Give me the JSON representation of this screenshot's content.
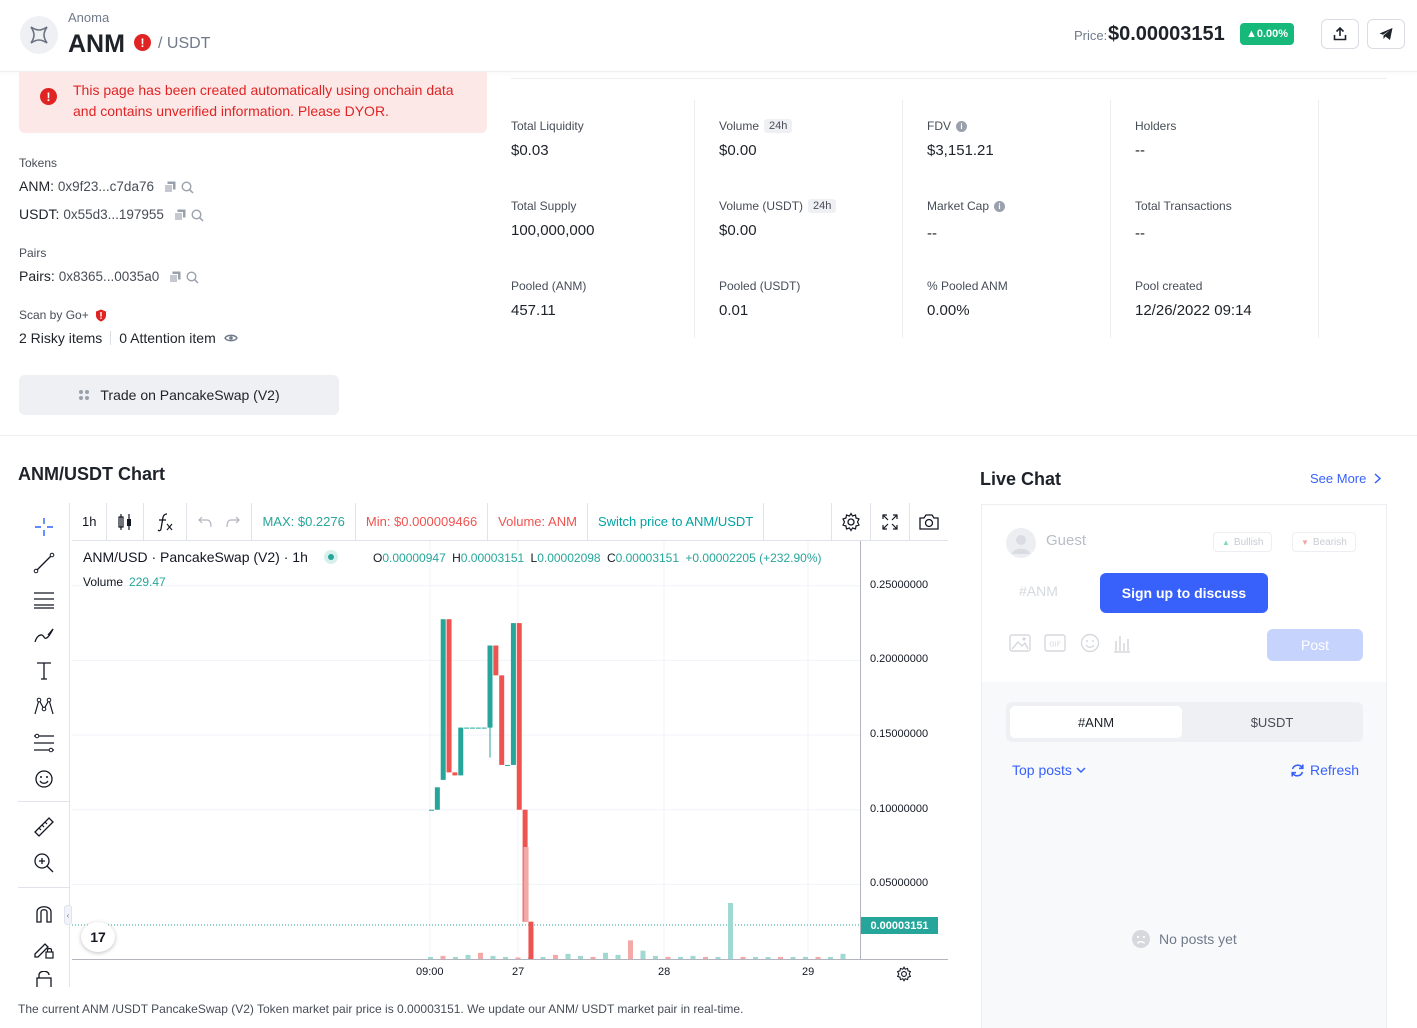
{
  "header": {
    "project_name": "Anoma",
    "symbol": "ANM",
    "quote": "/ USDT",
    "price_label": "Price:",
    "price": "$0.00003151",
    "price_change": "▲0.00%"
  },
  "warning": {
    "text": "This page has been created automatically using onchain data and contains unverified information. Please DYOR."
  },
  "tokens": {
    "label": "Tokens",
    "items": [
      {
        "name": "ANM:",
        "address": "0x9f23...c7da76"
      },
      {
        "name": "USDT:",
        "address": "0x55d3...197955"
      }
    ]
  },
  "pairs": {
    "label": "Pairs",
    "name": "Pairs:",
    "address": "0x8365...0035a0"
  },
  "scan": {
    "label": "Scan by Go+",
    "risky": "2 Risky items",
    "attention": "0 Attention item"
  },
  "trade_button": "Trade on PancakeSwap (V2)",
  "stats": [
    {
      "label": "Total Liquidity",
      "value": "$0.03"
    },
    {
      "label": "Volume",
      "tag": "24h",
      "value": "$0.00"
    },
    {
      "label": "FDV",
      "value": "$3,151.21"
    },
    {
      "label": "Holders",
      "value": "--"
    },
    {
      "label": "Total Supply",
      "value": "100,000,000"
    },
    {
      "label": "Volume (USDT)",
      "tag": "24h",
      "value": "$0.00"
    },
    {
      "label": "Market Cap",
      "value": "--"
    },
    {
      "label": "Total Transactions",
      "value": "--"
    },
    {
      "label": "Pooled (ANM)",
      "value": "457.11"
    },
    {
      "label": "Pooled (USDT)",
      "value": "0.01"
    },
    {
      "label": "% Pooled ANM",
      "value": "0.00%"
    },
    {
      "label": "Pool created",
      "value": "12/26/2022 09:14"
    }
  ],
  "chart": {
    "title": "ANM/USDT Chart",
    "toolbar": {
      "interval": "1h",
      "max": "MAX: $0.2276",
      "min": "Min: $0.000009466",
      "volume": "Volume: ANM",
      "switch": "Switch price to ANM/USDT"
    },
    "legend": "ANM/USD · PancakeSwap (V2) · 1h",
    "ohlc": {
      "o_label": "O",
      "o": "0.00000947",
      "h_label": "H",
      "h": "0.00003151",
      "l_label": "L",
      "l": "0.00002098",
      "c_label": "C",
      "c": "0.00003151",
      "change": "+0.00002205 (+232.90%)"
    },
    "volume_label": "Volume",
    "volume_value": "229.47",
    "last_price_tag": "0.00003151",
    "tv_logo": "17",
    "footnote": "The current ANM /USDT PancakeSwap (V2) Token market pair price is 0.00003151. We update our ANM/ USDT market pair in real-time."
  },
  "chart_data": {
    "type": "candlestick",
    "title": "ANM/USD · PancakeSwap (V2) · 1h",
    "yticks": [
      "0.25000000",
      "0.20000000",
      "0.15000000",
      "0.10000000",
      "0.05000000"
    ],
    "ylim": [
      0,
      0.28
    ],
    "xticks": [
      "09:00",
      "27",
      "28",
      "29"
    ],
    "candles": [
      {
        "o": 0.1,
        "h": 0.1,
        "l": 0.1,
        "c": 0.1
      },
      {
        "o": 0.1,
        "h": 0.115,
        "l": 0.1,
        "c": 0.115
      },
      {
        "o": 0.12,
        "h": 0.2276,
        "l": 0.12,
        "c": 0.2276
      },
      {
        "o": 0.2276,
        "h": 0.2276,
        "l": 0.125,
        "c": 0.125
      },
      {
        "o": 0.125,
        "h": 0.125,
        "l": 0.123,
        "c": 0.123
      },
      {
        "o": 0.123,
        "h": 0.155,
        "l": 0.123,
        "c": 0.155
      },
      {
        "o": 0.155,
        "h": 0.155,
        "l": 0.155,
        "c": 0.155
      },
      {
        "o": 0.155,
        "h": 0.155,
        "l": 0.155,
        "c": 0.155
      },
      {
        "o": 0.155,
        "h": 0.155,
        "l": 0.155,
        "c": 0.155
      },
      {
        "o": 0.155,
        "h": 0.155,
        "l": 0.155,
        "c": 0.155
      },
      {
        "o": 0.155,
        "h": 0.21,
        "l": 0.135,
        "c": 0.21
      },
      {
        "o": 0.21,
        "h": 0.21,
        "l": 0.19,
        "c": 0.19
      },
      {
        "o": 0.19,
        "h": 0.19,
        "l": 0.13,
        "c": 0.13
      },
      {
        "o": 0.13,
        "h": 0.13,
        "l": 0.13,
        "c": 0.13
      },
      {
        "o": 0.13,
        "h": 0.225,
        "l": 0.13,
        "c": 0.225
      },
      {
        "o": 0.225,
        "h": 0.225,
        "l": 0.1,
        "c": 0.1
      },
      {
        "o": 0.1,
        "h": 0.1,
        "l": 0.025,
        "c": 0.025
      },
      {
        "o": 0.025,
        "h": 0.025,
        "l": 0.0,
        "c": 0.0
      },
      {
        "o": 0.0,
        "h": 0.0,
        "l": 0.0,
        "c": 0.0
      }
    ],
    "volume": [
      2,
      3,
      2,
      4,
      6,
      3,
      2,
      1,
      1,
      2,
      4,
      5,
      3,
      2,
      6,
      4,
      18,
      8,
      3,
      2,
      2,
      3,
      2,
      2,
      54,
      2,
      2,
      2,
      2,
      2,
      2,
      2,
      2,
      5
    ],
    "last_price": 3.151e-05
  },
  "chat": {
    "title": "Live Chat",
    "see_more": "See More",
    "guest": "Guest",
    "bullish": "Bullish",
    "bearish": "Bearish",
    "placeholder": "#ANM",
    "signup": "Sign up to discuss",
    "post": "Post",
    "tabs": [
      "#ANM",
      "$USDT"
    ],
    "top_posts": "Top posts",
    "refresh": "Refresh",
    "no_posts": "No posts yet"
  },
  "colors": {
    "up": "#26a69a",
    "down": "#ef5350",
    "accent": "#3861fb",
    "danger": "#e02424"
  }
}
